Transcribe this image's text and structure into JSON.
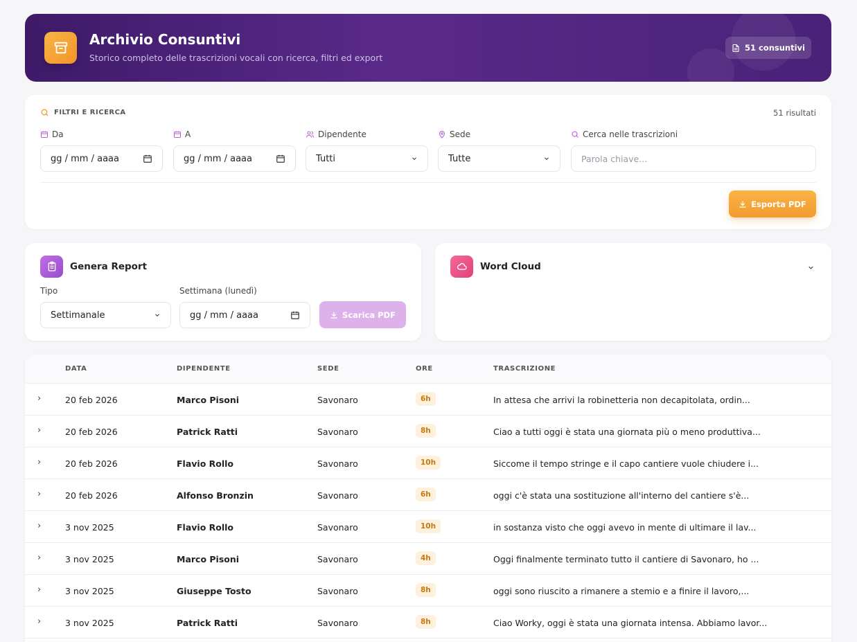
{
  "header": {
    "title": "Archivio Consuntivi",
    "subtitle": "Storico completo delle trascrizioni vocali con ricerca, filtri ed export",
    "badge": "51 consuntivi"
  },
  "filters": {
    "section_title": "FILTRI E RICERCA",
    "results": "51 risultati",
    "from_label": "Da",
    "from_value": "gg / mm / aaaa",
    "to_label": "A",
    "to_value": "gg / mm / aaaa",
    "employee_label": "Dipendente",
    "employee_value": "Tutti",
    "site_label": "Sede",
    "site_value": "Tutte",
    "search_label": "Cerca nelle trascrizioni",
    "search_placeholder": "Parola chiave...",
    "export_label": "Esporta PDF"
  },
  "report": {
    "title": "Genera Report",
    "type_label": "Tipo",
    "type_value": "Settimanale",
    "week_label": "Settimana (lunedì)",
    "week_value": "gg / mm / aaaa",
    "download_label": "Scarica PDF"
  },
  "wordcloud": {
    "title": "Word Cloud"
  },
  "table": {
    "columns": [
      "DATA",
      "DIPENDENTE",
      "SEDE",
      "ORE",
      "TRASCRIZIONE"
    ],
    "rows": [
      {
        "date": "20 feb 2026",
        "employee": "Marco Pisoni",
        "site": "Savonaro",
        "hours": "6h",
        "text": "In attesa che arrivi la robinetteria non decapitolata, ordin..."
      },
      {
        "date": "20 feb 2026",
        "employee": "Patrick Ratti",
        "site": "Savonaro",
        "hours": "8h",
        "text": "Ciao a tutti oggi è stata una giornata più o meno produttiva..."
      },
      {
        "date": "20 feb 2026",
        "employee": "Flavio Rollo",
        "site": "Savonaro",
        "hours": "10h",
        "text": "Siccome il tempo stringe e il capo cantiere vuole chiudere i..."
      },
      {
        "date": "20 feb 2026",
        "employee": "Alfonso Bronzin",
        "site": "Savonaro",
        "hours": "6h",
        "text": "oggi c'è stata una sostituzione all'interno del cantiere s'è..."
      },
      {
        "date": "3 nov 2025",
        "employee": "Flavio Rollo",
        "site": "Savonaro",
        "hours": "10h",
        "text": "in sostanza visto che oggi avevo in mente di ultimare il lav..."
      },
      {
        "date": "3 nov 2025",
        "employee": "Marco Pisoni",
        "site": "Savonaro",
        "hours": "4h",
        "text": "Oggi finalmente terminato tutto il cantiere di Savonaro, ho ..."
      },
      {
        "date": "3 nov 2025",
        "employee": "Giuseppe Tosto",
        "site": "Savonaro",
        "hours": "8h",
        "text": "oggi sono riuscito a rimanere a stemio e a finire il lavoro,..."
      },
      {
        "date": "3 nov 2025",
        "employee": "Patrick Ratti",
        "site": "Savonaro",
        "hours": "8h",
        "text": "Ciao Worky, oggi è stata una giornata intensa. Abbiamo lavor..."
      }
    ]
  },
  "colors": {
    "accent_orange": "#f29a30",
    "header_purple": "#4a2278",
    "report_purple": "#a857d4",
    "wordcloud_pink": "#ec4f86"
  }
}
